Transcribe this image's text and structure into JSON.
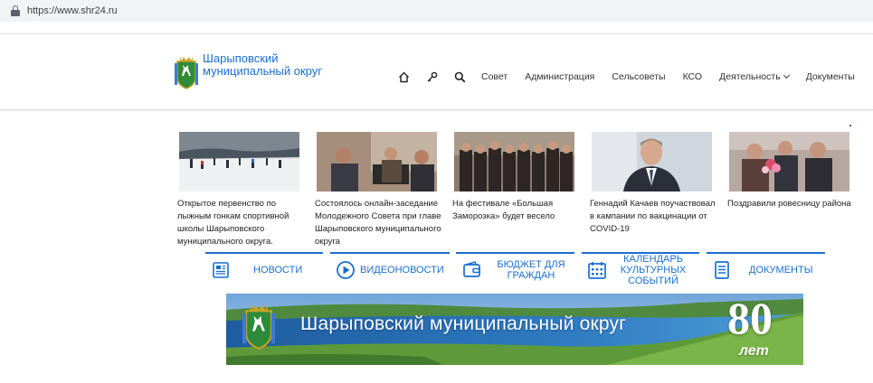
{
  "browser": {
    "url": "https://www.shr24.ru"
  },
  "header": {
    "site_title": "Шарыповский муниципальный округ",
    "nav_icons": [
      "home-icon",
      "key-icon",
      "search-icon"
    ],
    "nav_links": [
      {
        "label": "Совет"
      },
      {
        "label": "Администрация"
      },
      {
        "label": "Сельсоветы"
      },
      {
        "label": "КСО"
      },
      {
        "label": "Деятельность",
        "has_dropdown": true
      },
      {
        "label": "Документы"
      }
    ]
  },
  "news": [
    {
      "caption": "Открытое первенство по лыжным гонкам спортивной школы Шарыповского муниципального округа.",
      "image": "ski-race-photo"
    },
    {
      "caption": "Состоялось онлайн-заседание Молодежного Совета при главе Шарыповского муниципального округа",
      "image": "youth-council-photo"
    },
    {
      "caption": "На фестивале «Большая Заморозка» будет весело",
      "image": "festival-group-photo"
    },
    {
      "caption": "Геннадий Качаев поучаствовал в кампании по вакцинации от COVID-19",
      "image": "portrait-photo"
    },
    {
      "caption": "Поздравили ровесницу района",
      "image": "congratulation-photo"
    }
  ],
  "quick_links": [
    {
      "label": "НОВОСТИ",
      "icon": "newspaper-icon"
    },
    {
      "label": "ВИДЕОНОВОСТИ",
      "icon": "play-icon"
    },
    {
      "label": "БЮДЖЕТ ДЛЯ ГРАЖДАН",
      "icon": "wallet-icon"
    },
    {
      "label": "КАЛЕНДАРЬ КУЛЬТУРНЫХ СОБЫТИЙ",
      "icon": "calendar-icon"
    },
    {
      "label": "ДОКУМЕНТЫ",
      "icon": "document-icon"
    }
  ],
  "banner": {
    "text": "Шарыповский муниципальный округ",
    "number": "80",
    "suffix": "лет"
  },
  "colors": {
    "accent": "#1a6ecf",
    "coat_green": "#2e8b3a"
  }
}
